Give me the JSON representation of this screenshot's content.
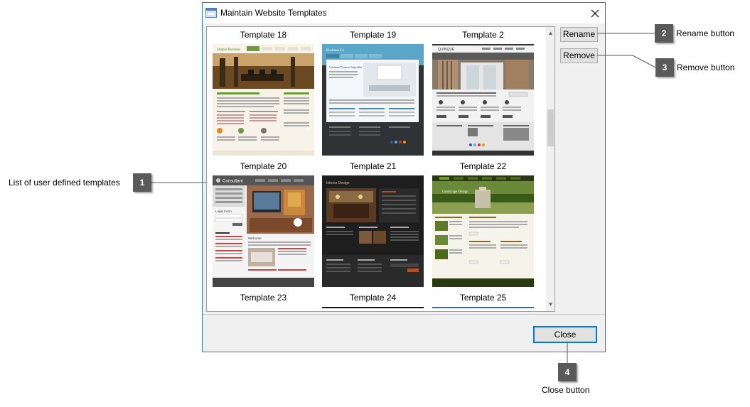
{
  "window": {
    "title": "Maintain Website Templates"
  },
  "templates": [
    {
      "label": "Template 18",
      "theme": "interior-office"
    },
    {
      "label": "Template 19",
      "theme": "business-blue"
    },
    {
      "label": "Template 2",
      "theme": "architecture"
    },
    {
      "label": "Template 20",
      "theme": "consultant"
    },
    {
      "label": "Template 21",
      "theme": "interior-design-dark"
    },
    {
      "label": "Template 22",
      "theme": "green-garden"
    },
    {
      "label": "Template 23",
      "theme": "partial"
    },
    {
      "label": "Template 24",
      "theme": "partial"
    },
    {
      "label": "Template 25",
      "theme": "partial"
    }
  ],
  "thumb_text": {
    "t18_brand": "Simple Business",
    "t19_brand": "Business Co",
    "t19_headline": "Vivamus Posuere Imperdiet",
    "t2_brand": "QUINQUE",
    "t20_brand": "Consultant",
    "t20_login": "Login Form",
    "t20_welcome": "Welcome",
    "t21_brand": "Interior Design",
    "t22_brand": "Landscape Design"
  },
  "buttons": {
    "rename": "Rename",
    "remove": "Remove",
    "close": "Close"
  },
  "callouts": [
    {
      "number": "1",
      "text": "List of user defined templates"
    },
    {
      "number": "2",
      "text": "Rename button"
    },
    {
      "number": "3",
      "text": "Remove button"
    },
    {
      "number": "4",
      "text": "Close button"
    }
  ],
  "colors": {
    "accent": "#0078d7",
    "badge": "#5a5a5a",
    "window_border": "#2b78c5"
  }
}
